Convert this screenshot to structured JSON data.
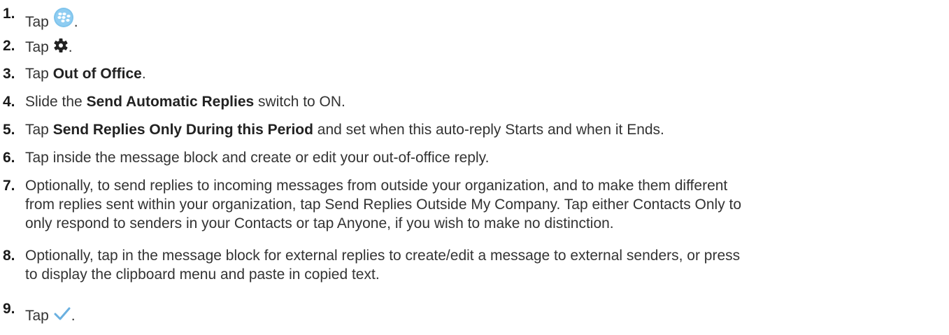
{
  "steps": [
    {
      "num": "1.",
      "pre": "Tap",
      "icon": "blackberry-hub-icon",
      "post": "."
    },
    {
      "num": "2.",
      "pre": "Tap",
      "icon": "gear-icon",
      "post": "."
    },
    {
      "num": "3.",
      "pre": "Tap",
      "bold": "Out of Office",
      "post": "."
    },
    {
      "num": "4.",
      "pre": "Slide the",
      "bold": "Send Automatic Replies",
      "post": "switch to ON."
    },
    {
      "num": "5.",
      "pre": "Tap",
      "bold": "Send Replies Only During this Period",
      "post": "and set when this auto-reply Starts and when it Ends."
    },
    {
      "num": "6.",
      "text": "Tap inside the message block and create or edit your out-of-office reply."
    },
    {
      "num": "7.",
      "lines": [
        "Optionally, to send replies to incoming messages from outside your organization, and to make them different",
        "from replies sent within your organization, tap Send Replies Outside My Company. Tap either Contacts Only to",
        "only respond to senders in your Contacts or tap Anyone, if you wish to make no distinction."
      ]
    },
    {
      "num": "8.",
      "lines": [
        "Optionally, tap in the message block for external replies to create/edit a message to external senders, or press",
        "to display the clipboard menu and paste in copied text."
      ]
    },
    {
      "num": "9.",
      "pre": "Tap",
      "icon": "checkmark-icon",
      "post": "."
    }
  ],
  "colors": {
    "hub_icon": "#7fc4ec",
    "checkmark": "#6ab0e0",
    "text": "#333333"
  }
}
